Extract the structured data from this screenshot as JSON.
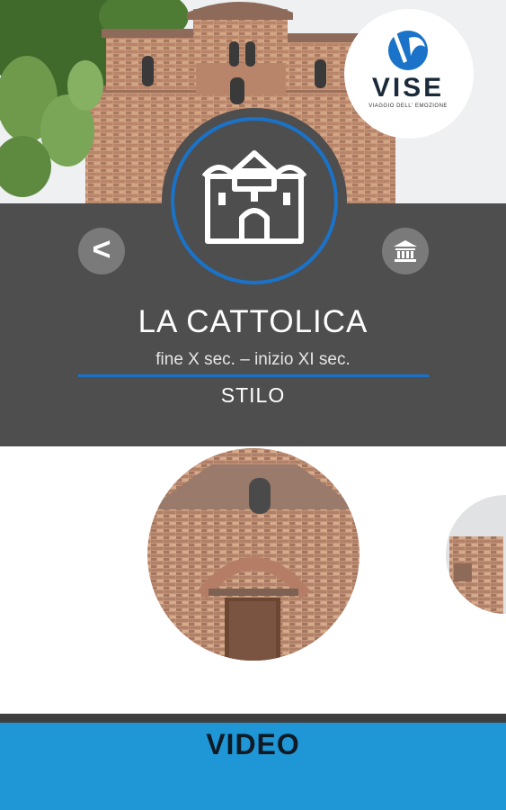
{
  "logo": {
    "text": "VISE",
    "tagline": "VIAGGIO DELL' EMOZIONE"
  },
  "site": {
    "name": "LA CATTOLICA",
    "period": "fine X sec. – inizio XI sec.",
    "town": "STILO",
    "type_icon": "church-icon"
  },
  "nav": {
    "back_label": "<",
    "back_icon": "chevron-left-icon",
    "museum_icon": "museum-icon"
  },
  "video": {
    "label": "VIDEO"
  },
  "colors": {
    "accent": "#1f97d6",
    "panel": "#4e4e4e",
    "button": "#7a7a7a",
    "ring": "#1a73c9"
  }
}
